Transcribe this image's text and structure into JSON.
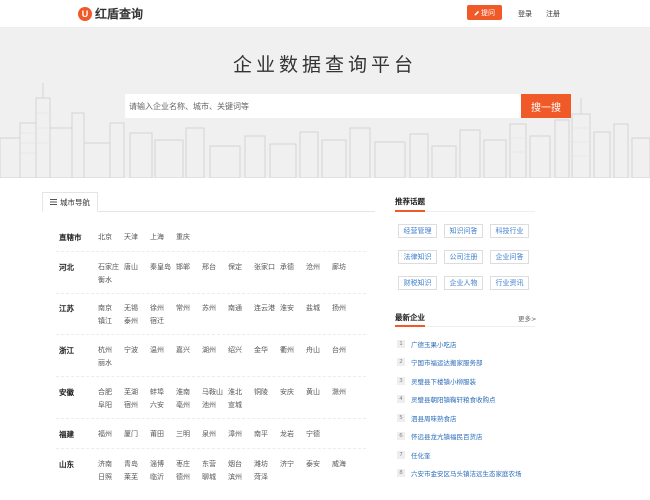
{
  "header": {
    "logo_mark": "U",
    "logo_text": "红盾查询",
    "ask_label": "提问",
    "login_label": "登录",
    "register_label": "注册"
  },
  "hero": {
    "title": "企业数据查询平台",
    "search_placeholder": "请输入企业名称、城市、关键词等",
    "search_button": "搜一搜"
  },
  "city_nav": {
    "tab_label": "城市导航",
    "provinces": [
      {
        "name": "直辖市",
        "cities": [
          "北京",
          "天津",
          "上海",
          "重庆"
        ]
      },
      {
        "name": "河北",
        "cities": [
          "石家庄",
          "唐山",
          "秦皇岛",
          "邯郸",
          "邢台",
          "保定",
          "张家口",
          "承德",
          "沧州",
          "廊坊",
          "衡水"
        ]
      },
      {
        "name": "江苏",
        "cities": [
          "南京",
          "无锡",
          "徐州",
          "常州",
          "苏州",
          "南通",
          "连云港",
          "淮安",
          "盐城",
          "扬州",
          "镇江",
          "泰州",
          "宿迁"
        ]
      },
      {
        "name": "浙江",
        "cities": [
          "杭州",
          "宁波",
          "温州",
          "嘉兴",
          "湖州",
          "绍兴",
          "金华",
          "衢州",
          "舟山",
          "台州",
          "丽水"
        ]
      },
      {
        "name": "安徽",
        "cities": [
          "合肥",
          "芜湖",
          "蚌埠",
          "淮南",
          "马鞍山",
          "淮北",
          "铜陵",
          "安庆",
          "黄山",
          "滁州",
          "阜阳",
          "宿州",
          "六安",
          "亳州",
          "池州",
          "宣城"
        ]
      },
      {
        "name": "福建",
        "cities": [
          "福州",
          "厦门",
          "莆田",
          "三明",
          "泉州",
          "漳州",
          "南平",
          "龙岩",
          "宁德"
        ]
      },
      {
        "name": "山东",
        "cities": [
          "济南",
          "青岛",
          "淄博",
          "枣庄",
          "东营",
          "烟台",
          "潍坊",
          "济宁",
          "泰安",
          "威海",
          "日照",
          "莱芜",
          "临沂",
          "德州",
          "聊城",
          "滨州",
          "菏泽"
        ]
      }
    ]
  },
  "topics": {
    "title": "推荐话题",
    "tags": [
      "经营管理",
      "知识问答",
      "科技行业",
      "法律知识",
      "公司注册",
      "企业问答",
      "财税知识",
      "企业人物",
      "行业资讯"
    ]
  },
  "latest": {
    "title": "最新企业",
    "more_label": "更多>",
    "items": [
      {
        "num": "1",
        "name": "广德玉果小吃店"
      },
      {
        "num": "2",
        "name": "宁国市福运达搬家服务部"
      },
      {
        "num": "3",
        "name": "灵璧县下楼镇小柳服装"
      },
      {
        "num": "4",
        "name": "灵璧县朝阳镇鞠轩粮食收购点"
      },
      {
        "num": "5",
        "name": "泗县周味熟食店"
      },
      {
        "num": "6",
        "name": "怀远县龙亢镇福民百货店"
      },
      {
        "num": "7",
        "name": "任化奎"
      },
      {
        "num": "8",
        "name": "六安市金安区马头镇洁远生态家庭农场"
      }
    ]
  },
  "colors": {
    "accent": "#f05a28",
    "link": "#2a6db8"
  }
}
